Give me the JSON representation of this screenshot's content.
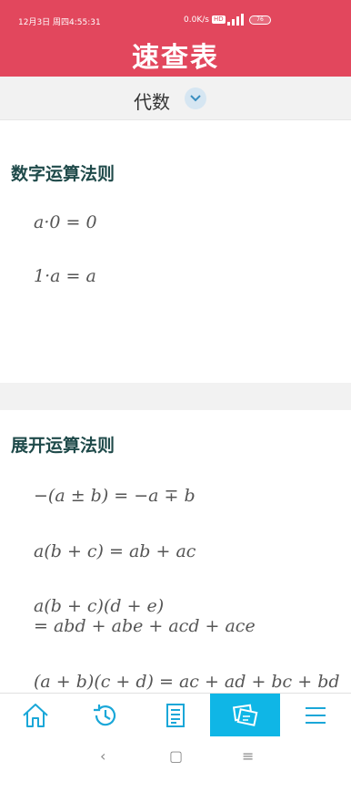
{
  "status": {
    "time": "12月3日 周四4:55:31",
    "network": "0.0K/s",
    "hd": "HD",
    "battery": "76"
  },
  "header": {
    "title": "速查表"
  },
  "category": {
    "label": "代数"
  },
  "sections": [
    {
      "title": "数字运算法则",
      "formulas": [
        "a·0 = 0",
        "1·a = a"
      ]
    },
    {
      "title": "展开运算法则",
      "formulas": [
        "−(a ± b) = −a ∓ b",
        "a(b + c) = ab + ac",
        "a(b + c)(d + e)",
        "= abd + abe + acd + ace",
        "(a + b)(c + d) = ac + ad + bc + bd"
      ]
    }
  ],
  "tabs": [
    {
      "icon": "home-icon",
      "active": false
    },
    {
      "icon": "history-icon",
      "active": false
    },
    {
      "icon": "document-icon",
      "active": false
    },
    {
      "icon": "cards-icon",
      "active": true
    },
    {
      "icon": "menu-icon",
      "active": false
    }
  ],
  "system_nav": {
    "back": "‹",
    "home": "▢",
    "menu": "≡"
  },
  "colors": {
    "header": "#e2475d",
    "active_tab": "#0fb6e6",
    "icon": "#1aa7d8",
    "section_title": "#1f4a4a"
  }
}
